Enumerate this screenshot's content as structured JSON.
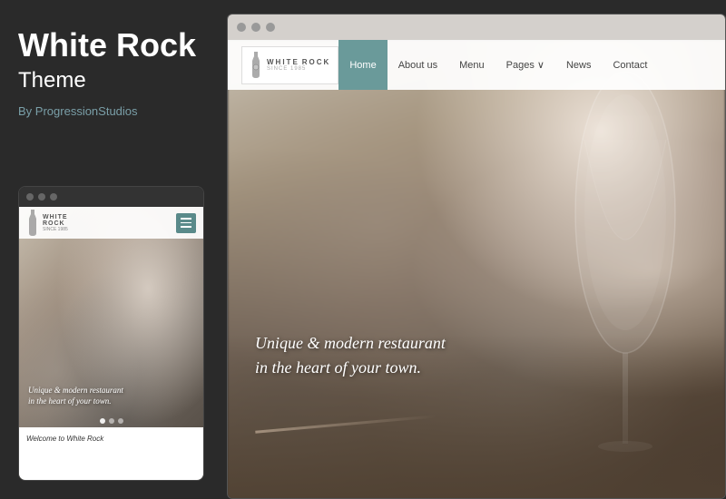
{
  "theme": {
    "name_line1": "White Rock",
    "name_line2": "Theme",
    "author_prefix": "By",
    "author": "ProgressionStudios"
  },
  "mobile_preview": {
    "dots": [
      "●",
      "●",
      "●"
    ],
    "nav": {
      "logo_white": "WHITE",
      "logo_rock": "ROCK",
      "logo_since": "SINCE 1985"
    },
    "hero_text_line1": "Unique & modern restaurant",
    "hero_text_line2": "in the heart of your town.",
    "bottom_text": "Welcome to White Rock"
  },
  "desktop_preview": {
    "titlebar_dots": [
      "●",
      "●",
      "●"
    ],
    "nav": {
      "logo_white": "WHITE",
      "logo_rock": "ROCK",
      "logo_since": "SINCE 1985",
      "links": [
        {
          "label": "Home",
          "active": true
        },
        {
          "label": "About us",
          "active": false
        },
        {
          "label": "Menu",
          "active": false
        },
        {
          "label": "Pages ∨",
          "active": false
        },
        {
          "label": "News",
          "active": false
        },
        {
          "label": "Contact",
          "active": false
        }
      ]
    },
    "hero_text_line1": "Unique & modern restaurant",
    "hero_text_line2": "in the heart of your town."
  },
  "colors": {
    "dark_bg": "#2a2a2a",
    "teal_accent": "#6a9a9a",
    "teal_author": "#7a9fa8",
    "nav_bg": "rgba(255,255,255,0.93)"
  }
}
